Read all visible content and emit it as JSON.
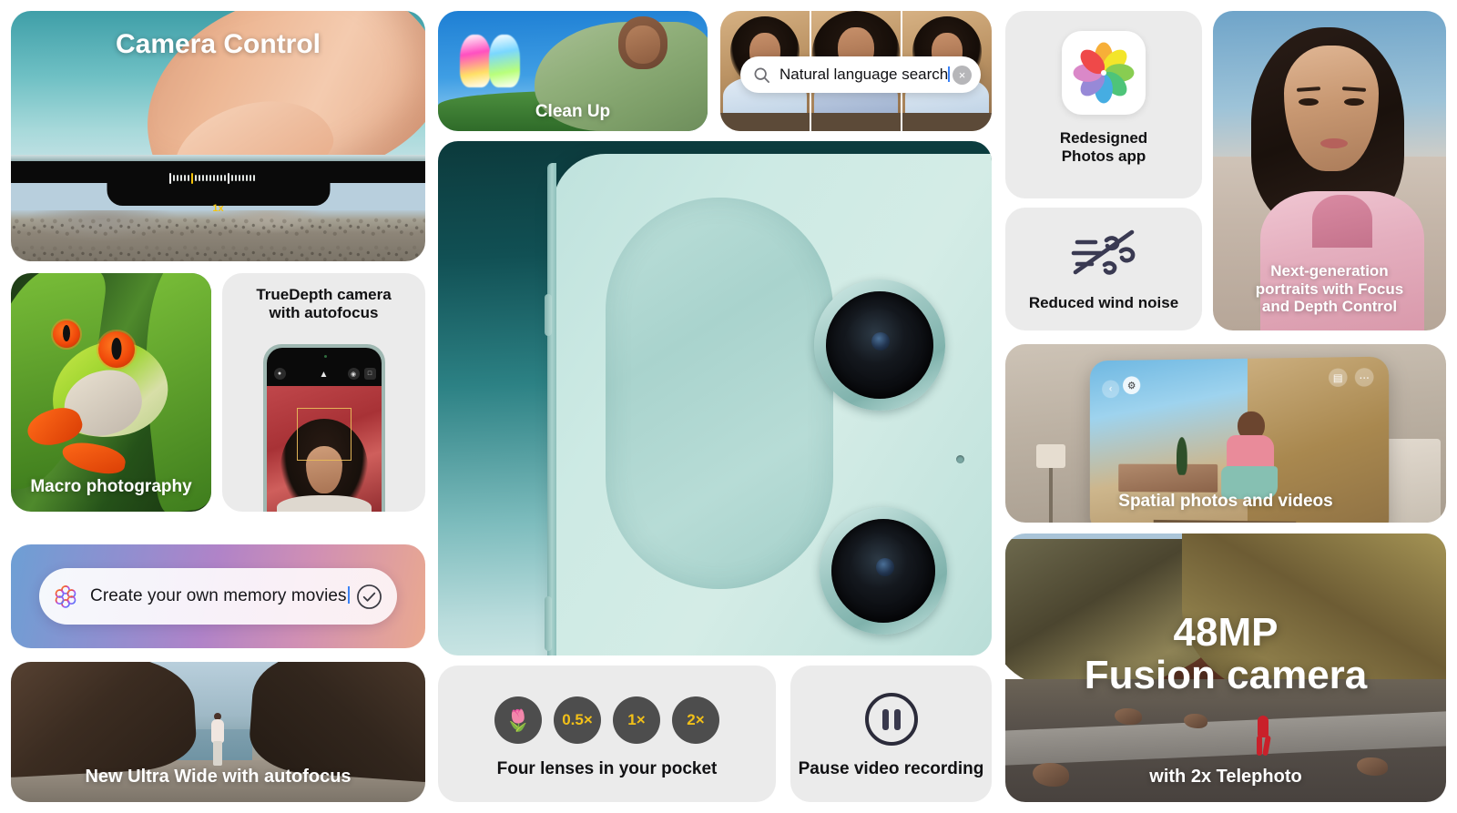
{
  "cards": {
    "camera_control": {
      "title": "Camera Control",
      "zoom_label": "1x"
    },
    "macro": {
      "caption": "Macro photography"
    },
    "truedepth": {
      "caption": "TrueDepth camera\nwith autofocus",
      "line1": "TrueDepth camera",
      "line2": "with autofocus"
    },
    "memory": {
      "value": "Create your own memory movies",
      "sparkle_icon": "apple-intelligence-sparkle-icon",
      "confirm_icon": "check-circle-icon"
    },
    "ultrawide": {
      "caption": "New Ultra Wide with autofocus"
    },
    "cleanup": {
      "caption": "Clean Up"
    },
    "search": {
      "value": "Natural language search",
      "search_icon": "search-icon",
      "clear_icon": "clear-circle-icon",
      "clear_glyph": "×"
    },
    "hero": {
      "alt": "iPhone dual camera close-up"
    },
    "lenses": {
      "caption": "Four lenses in your pocket",
      "buttons": [
        {
          "label": "🌷",
          "name": "macro-lens-button"
        },
        {
          "label": "0.5×",
          "name": "ultrawide-lens-button"
        },
        {
          "label": "1×",
          "name": "wide-lens-button"
        },
        {
          "label": "2×",
          "name": "telephoto-lens-button"
        }
      ]
    },
    "pause": {
      "caption": "Pause video recording",
      "icon": "pause-circle-icon"
    },
    "photos_app": {
      "line1": "Redesigned",
      "line2": "Photos app",
      "icon": "photos-app-icon"
    },
    "wind": {
      "caption": "Reduced wind noise",
      "icon": "wind-noise-off-icon"
    },
    "portraits": {
      "line1": "Next-generation",
      "line2": "portraits with Focus",
      "line3": "and Depth Control"
    },
    "spatial": {
      "caption": "Spatial photos and videos"
    },
    "fusion": {
      "title_line1": "48MP",
      "title_line2": "Fusion camera",
      "caption": "with 2x Telephoto"
    }
  },
  "colors": {
    "card_grey": "#ebebeb",
    "page_bg": "#ffffff",
    "accent_yellow": "#f2c018",
    "lens_pill": "#4d4d4d",
    "caret_blue": "#3b82f6",
    "hero_teal_dark": "#0c3a3c",
    "hero_teal_light": "#cfe8e6"
  }
}
